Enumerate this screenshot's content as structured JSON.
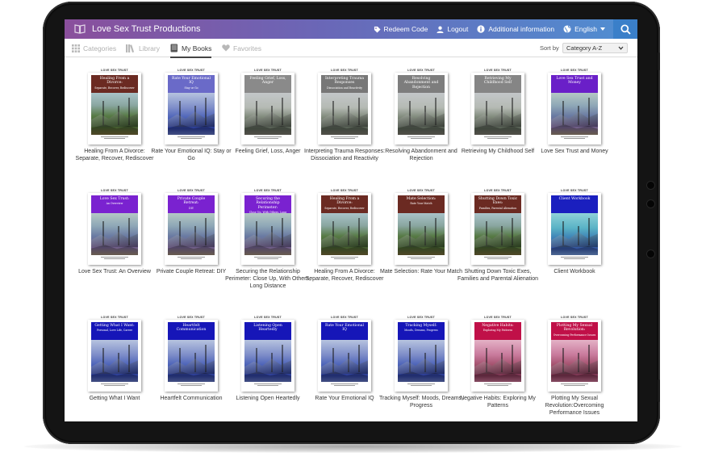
{
  "app": {
    "title": "Love Sex Trust Productions"
  },
  "topnav": [
    {
      "id": "redeem",
      "label": "Redeem Code",
      "icon": "tag-icon"
    },
    {
      "id": "logout",
      "label": "Logout",
      "icon": "user-icon"
    },
    {
      "id": "info",
      "label": "Additional information",
      "icon": "info-icon"
    },
    {
      "id": "lang",
      "label": "English",
      "icon": "globe-icon"
    }
  ],
  "tabs": [
    {
      "label": "Categories",
      "icon": "grid-icon",
      "active": false
    },
    {
      "label": "Library",
      "icon": "library-icon",
      "active": false
    },
    {
      "label": "My Books",
      "icon": "book-icon",
      "active": true
    },
    {
      "label": "Favorites",
      "icon": "heart-icon",
      "active": false
    }
  ],
  "sort": {
    "label": "Sort by",
    "value": "Category A-Z"
  },
  "brand_label": "LOVE SEX TRUST",
  "colors": {
    "gradient_start": "#8a4f9c",
    "gradient_end": "#4f8fd2",
    "search_bg": "#3a7fc9"
  },
  "books": [
    {
      "caption": "Healing From A Divorce: Separate, Recover, Rediscover",
      "cover_title": "Healing From a Divorce:",
      "cover_subtitle": "Separate, Recover, Rediscover",
      "band": "#6b2a22",
      "art": "green"
    },
    {
      "caption": "Rate Your Emotional IQ: Stay or Go",
      "cover_title": "Rate Your Emotional IQ",
      "cover_subtitle": "Stay or Go",
      "band": "#6a6ac8",
      "art": "blue"
    },
    {
      "caption": "Feeling Grief, Loss, Anger",
      "cover_title": "Feeling Grief, Loss, Anger",
      "cover_subtitle": "",
      "band": "#8a8a8a",
      "art": "gray"
    },
    {
      "caption": "Interpreting Trauma Responses: Dissociation and Reactivity",
      "cover_title": "Interpreting Trauma Responses",
      "cover_subtitle": "Dissociation and Reactivity",
      "band": "#777777",
      "art": "gray"
    },
    {
      "caption": "Resolving Abandonment and Rejection",
      "cover_title": "Resolving Abandonment and Rejection",
      "cover_subtitle": "",
      "band": "#7d7d7d",
      "art": "gray"
    },
    {
      "caption": "Retrieving My Childhood Self",
      "cover_title": "Retrieving My Childhood Self",
      "cover_subtitle": "",
      "band": "#858585",
      "art": "gray"
    },
    {
      "caption": "Love Sex Trust and Money",
      "cover_title": "Love Sex Trust and Money",
      "cover_subtitle": "",
      "band": "#6a1fc8",
      "art": "violet"
    },
    {
      "caption": "Love Sex Trust: An Overview",
      "cover_title": "Love Sex Trust:",
      "cover_subtitle": "An Overview",
      "band": "#7a22d0",
      "art": "violet"
    },
    {
      "caption": "Private Couple Retreat: DIY",
      "cover_title": "Private Couple Retreat:",
      "cover_subtitle": "DIY",
      "band": "#7a22d0",
      "art": "violet"
    },
    {
      "caption": "Securing the Relationship Perimeter: Close Up, With Others, Long Distance",
      "cover_title": "Securing the Relationship Perimeter:",
      "cover_subtitle": "Close Up, With Others, Long Distance",
      "band": "#7a22d0",
      "art": "violet"
    },
    {
      "caption": "Healing From A Divorce: Separate, Recover, Rediscover",
      "cover_title": "Healing From a Divorce:",
      "cover_subtitle": "Separate, Recover, Rediscover",
      "band": "#6b2a22",
      "art": "green"
    },
    {
      "caption": "Mate Selection: Rate Your Match",
      "cover_title": "Mate Selection:",
      "cover_subtitle": "Rate Your Match",
      "band": "#6b2a22",
      "art": "green"
    },
    {
      "caption": "Shutting Down Toxic Exes, Families and Parental Alienation",
      "cover_title": "Shutting Down Toxic Exes:",
      "cover_subtitle": "Families, Parental Alienation",
      "band": "#6b2a22",
      "art": "green"
    },
    {
      "caption": "Client Workbook",
      "cover_title": "Client Workbook",
      "cover_subtitle": "",
      "band": "#1a1fbf",
      "art": "cyan"
    },
    {
      "caption": "Getting What I Want",
      "cover_title": "Getting What I Want:",
      "cover_subtitle": "Personal, Love Life, Career",
      "band": "#1616b8",
      "art": "blue"
    },
    {
      "caption": "Heartfelt Communication",
      "cover_title": "Heartfelt Communication",
      "cover_subtitle": "",
      "band": "#1616b8",
      "art": "blue"
    },
    {
      "caption": "Listening Open Heartedly",
      "cover_title": "Listening Open Heartedly",
      "cover_subtitle": "",
      "band": "#1616b8",
      "art": "blue"
    },
    {
      "caption": "Rate Your Emotional IQ",
      "cover_title": "Rate Your Emotional IQ",
      "cover_subtitle": "",
      "band": "#1616b8",
      "art": "blue"
    },
    {
      "caption": "Tracking Myself: Moods, Dreams, Progress",
      "cover_title": "Tracking Myself:",
      "cover_subtitle": "Moods, Dreams, Progress",
      "band": "#1616b8",
      "art": "blue"
    },
    {
      "caption": "Negative Habits: Exploring My Patterns",
      "cover_title": "Negative Habits:",
      "cover_subtitle": "Exploring My Patterns",
      "band": "#c01048",
      "art": "pink"
    },
    {
      "caption": "Plotting My Sexual Revolution:Overcoming Performance Issues",
      "cover_title": "Plotting My Sexual Revolution:",
      "cover_subtitle": "Overcoming Performance Issues",
      "band": "#c01048",
      "art": "pink"
    }
  ]
}
